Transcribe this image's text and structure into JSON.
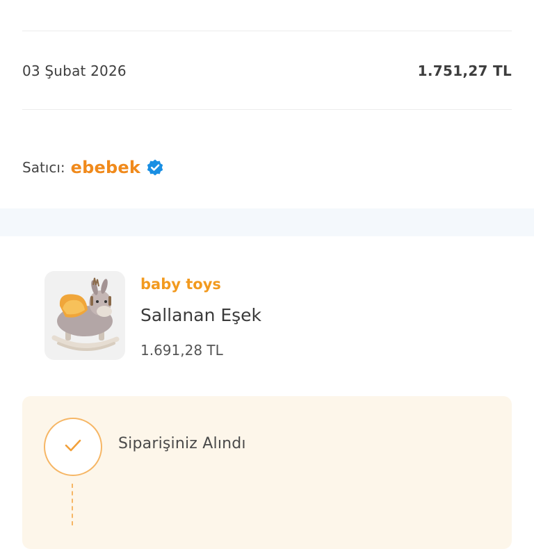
{
  "order": {
    "date": "03 Şubat 2026",
    "total": "1.751,27 TL"
  },
  "seller": {
    "label": "Satıcı:",
    "name": "ebebek",
    "verified_icon": "verified-badge-icon",
    "brand_color": "#f08a1c"
  },
  "product": {
    "brand": "baby toys",
    "name": "Sallanan Eşek",
    "price": "1.691,28 TL",
    "image": "rocking-donkey-toy"
  },
  "status": {
    "steps": [
      {
        "label": "Siparişiniz Alındı",
        "icon": "check-icon",
        "done": true
      }
    ]
  },
  "colors": {
    "accent": "#f08a1c",
    "status_bg": "#fdf6ea",
    "verified": "#1a8fe3"
  }
}
